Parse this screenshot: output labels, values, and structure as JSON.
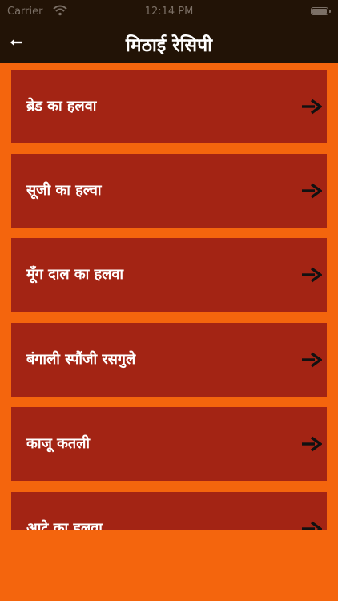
{
  "status_bar": {
    "carrier": "Carrier",
    "time": "12:14 PM",
    "icons": [
      "wifi-icon",
      "battery-icon"
    ]
  },
  "header": {
    "title": "मिठाई रेसिपी",
    "back_icon": "back-arrow-icon"
  },
  "recipes": [
    {
      "label": "ब्रेड का हलवा"
    },
    {
      "label": "सूजी का हल्वा"
    },
    {
      "label": "मूँग दाल का हलवा"
    },
    {
      "label": "बंगाली स्पौंजी रसगुले"
    },
    {
      "label": "काजू कतली"
    },
    {
      "label": "आटे का हलवा"
    }
  ],
  "item_icon": "right-arrow-icon",
  "colors": {
    "background": "#f4650d",
    "card": "#a32414",
    "bar": "#221306",
    "text": "#ffffff",
    "arrow": "#111111"
  }
}
